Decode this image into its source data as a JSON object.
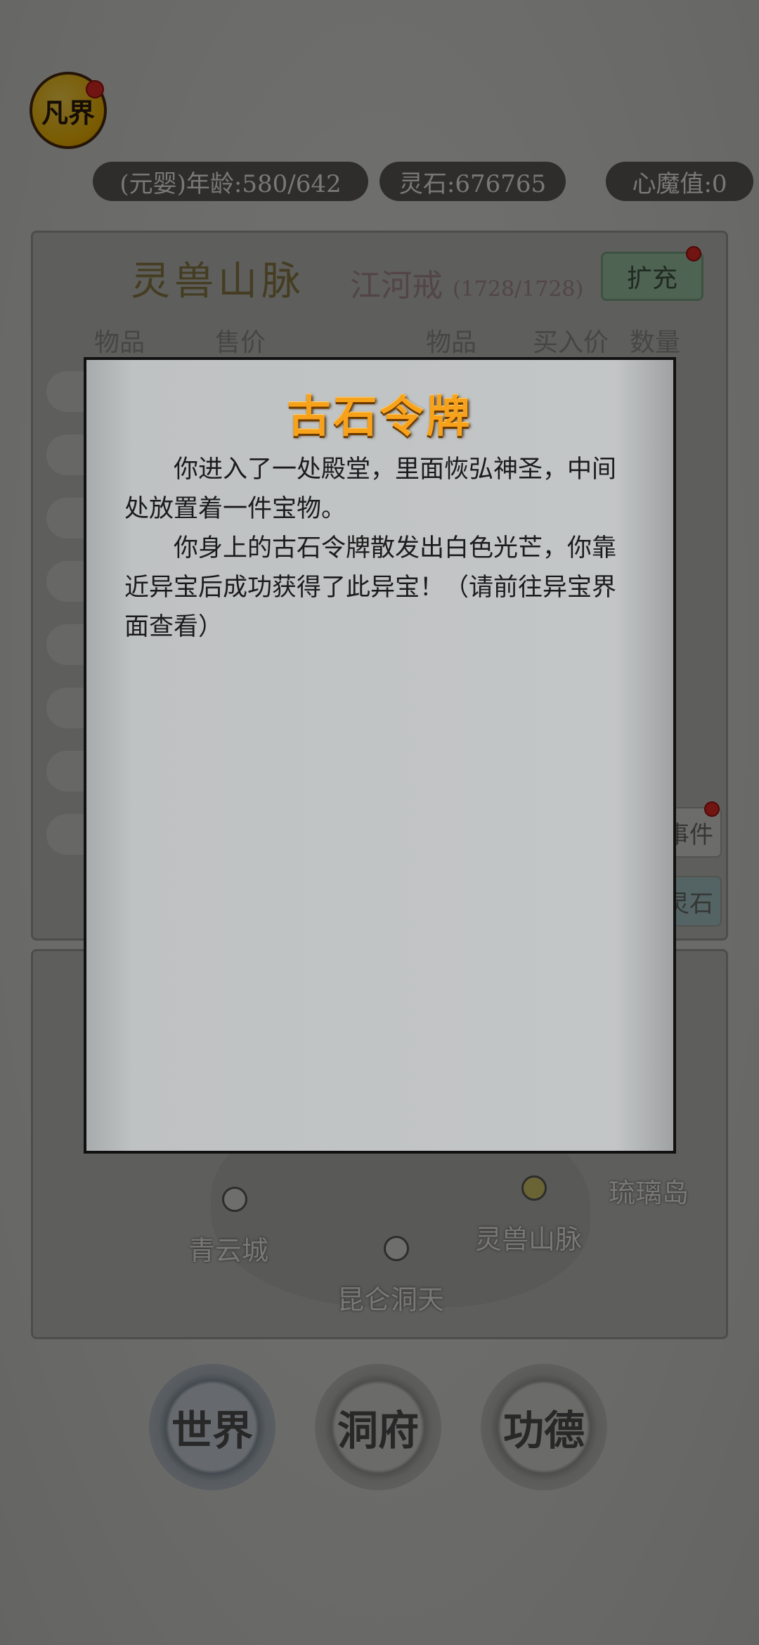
{
  "player": {
    "avatar_text": "凡界",
    "age_label": "(元婴)年龄:580/642",
    "spirit_stone_label": "灵石:676765",
    "heart_demon_label": "心魔值:0"
  },
  "shop": {
    "region_title": "灵兽山脉",
    "ring_name": "江河戒",
    "ring_capacity": "(1728/1728)",
    "expand_label": "扩充",
    "columns_left": [
      "物品",
      "售价"
    ],
    "columns_right": [
      "物品",
      "买入价",
      "数量"
    ],
    "side_buttons": [
      "事件",
      "灵石"
    ]
  },
  "map": {
    "locations": [
      {
        "name": "青云城"
      },
      {
        "name": "昆仑洞天"
      },
      {
        "name": "灵兽山脉"
      },
      {
        "name": "琉璃岛"
      }
    ]
  },
  "nav": {
    "world": "世界",
    "cave": "洞府",
    "merit": "功德"
  },
  "dialog": {
    "title": "古石令牌",
    "paragraph1": "你进入了一处殿堂，里面恢弘神圣，中间处放置着一件宝物。",
    "paragraph2": "你身上的古石令牌散发出白色光芒，你靠近异宝后成功获得了此异宝！（请前往异宝界面查看）"
  },
  "colors": {
    "title_gold": "#f7a21a",
    "badge_red": "#e02b22",
    "expand_green": "#9fc7a6"
  }
}
